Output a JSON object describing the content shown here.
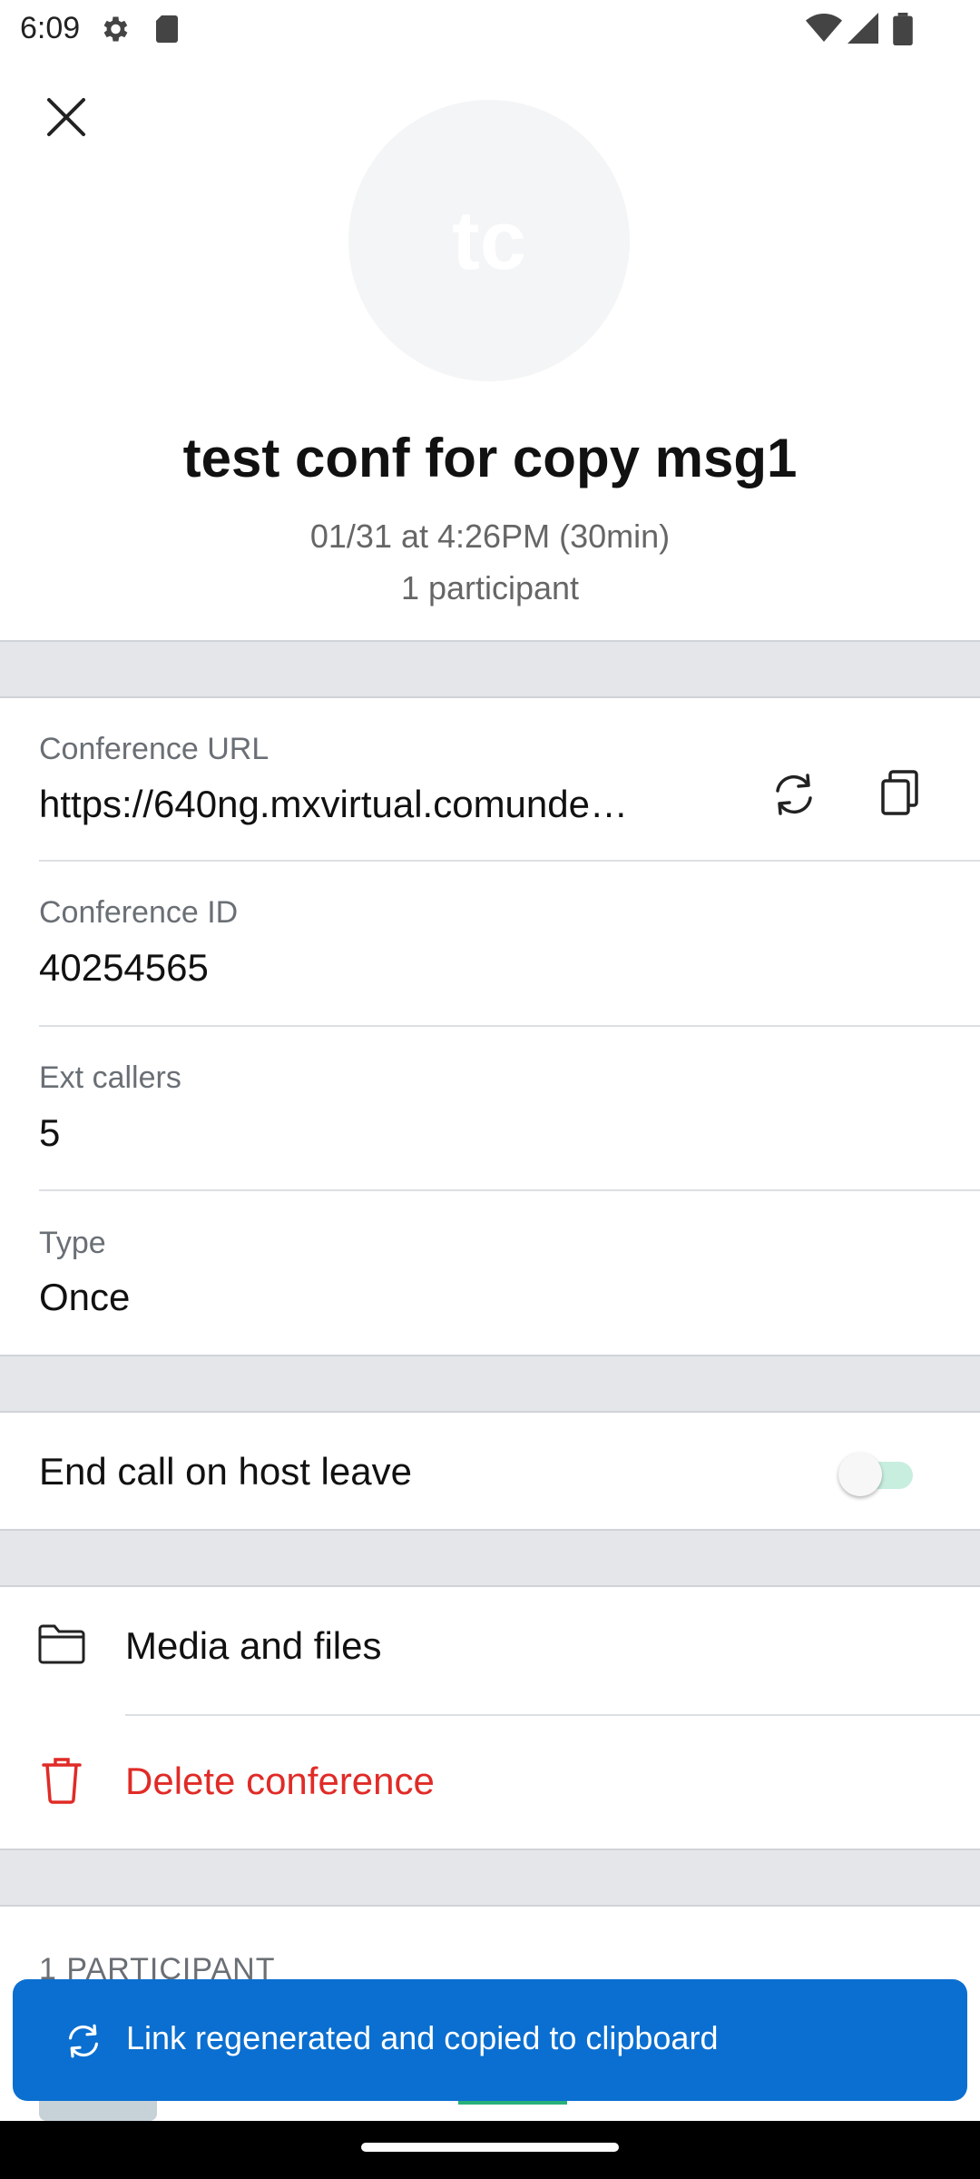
{
  "status_bar": {
    "time": "6:09"
  },
  "header": {
    "avatar_initials": "tc",
    "title": "test conf for copy msg1",
    "datetime": "01/31 at 4:26PM (30min)",
    "participants": "1 participant"
  },
  "details": {
    "url_label": "Conference URL",
    "url_value": "https://640ng.mxvirtual.comunde…",
    "id_label": "Conference ID",
    "id_value": "40254565",
    "ext_label": "Ext callers",
    "ext_value": "5",
    "type_label": "Type",
    "type_value": "Once"
  },
  "settings": {
    "end_call_label": "End call on host leave",
    "end_call_enabled": false
  },
  "actions": {
    "media_label": "Media and files",
    "delete_label": "Delete conference"
  },
  "participants_section": {
    "header": "1 PARTICIPANT"
  },
  "toast": {
    "message": "Link regenerated and copied to clipboard"
  },
  "colors": {
    "accent": "#0a6fd0",
    "danger": "#e02b27",
    "toggle_track": "#c8eee0"
  },
  "icons": [
    "settings-icon",
    "sd-card-icon",
    "wifi-icon",
    "signal-icon",
    "battery-icon",
    "close-icon",
    "refresh-icon",
    "copy-icon",
    "folder-icon",
    "trash-icon"
  ]
}
